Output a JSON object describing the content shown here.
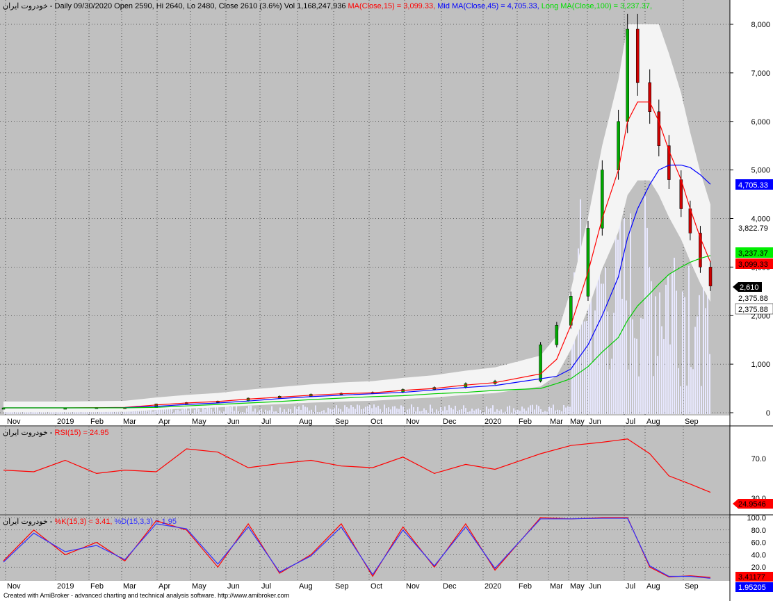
{
  "main_header": {
    "symbol": "خودروت ایران",
    "info": " - Daily 09/30/2020 Open 2590, Hi 2640, Lo 2480, Close 2610 (3.6%) Vol 1,168,247,936 ",
    "ma_label": "MA(Close,15) = 3,099.33, ",
    "mid_label": "Mid MA(Close,45) = 4,705.33, ",
    "long_label": "Long MA(Close,100) = 3,237.37,"
  },
  "rsi_header": {
    "symbol": "خودروت ایران",
    "sep": " - ",
    "label": "RSI(15) = 24.95"
  },
  "stoch_header": {
    "symbol": "خودروت ایران",
    "sep": " - ",
    "k_label": "%K(15,3) = 3.41, ",
    "d_label": "%D(15,3,3) = 1.95"
  },
  "main_axis": [
    "8,000",
    "7,000",
    "6,000",
    "5,000",
    "4,000",
    "3,000",
    "2,000",
    "1,000",
    "0"
  ],
  "rsi_axis": [
    "70.0",
    "30.0"
  ],
  "stoch_axis": [
    "100.0",
    "80.0",
    "60.0",
    "40.0",
    "20.0"
  ],
  "badges": {
    "mid": "4,705.33",
    "upper": "3,822.79",
    "long": "3,237.37",
    "ma": "3,099.33",
    "close": "2,610",
    "lower1": "2,375.88",
    "lower2": "2,375.88",
    "rsi": "24.9546",
    "k": "3.41177",
    "d": "1.95205"
  },
  "months": [
    "Nov",
    "2019",
    "Feb",
    "Mar",
    "Apr",
    "May",
    "Jun",
    "Jul",
    "Aug",
    "Sep",
    "Oct",
    "Nov",
    "Dec",
    "2020",
    "Feb",
    "Mar",
    "May",
    "Jun",
    "Jul",
    "Aug",
    "Sep"
  ],
  "footer": "Created with AmiBroker - advanced charting and technical analysis software. http://www.amibroker.com",
  "colors": {
    "ma": "#ff0000",
    "mid": "#0000ff",
    "long": "#00cc00",
    "rsi": "#ff0000",
    "k": "#ff0000",
    "d": "#3030ff",
    "background": "#c0c0c0"
  },
  "chart_data": [
    {
      "type": "line",
      "title": "Daily 09/30/2020 Open 2590, Hi 2640, Lo 2480, Close 2610 (3.6%) Vol 1,168,247,936",
      "ylim": [
        0,
        8000
      ],
      "x": [
        "2018-11-01",
        "2019-01-01",
        "2019-02-01",
        "2019-03-01",
        "2019-04-01",
        "2019-05-01",
        "2019-06-01",
        "2019-07-01",
        "2019-08-01",
        "2019-09-01",
        "2019-10-01",
        "2019-11-01",
        "2019-12-01",
        "2020-01-01",
        "2020-02-01",
        "2020-03-01",
        "2020-04-15",
        "2020-05-01",
        "2020-05-15",
        "2020-06-01",
        "2020-06-15",
        "2020-07-01",
        "2020-07-10",
        "2020-07-20",
        "2020-08-01",
        "2020-08-10",
        "2020-08-20",
        "2020-09-01",
        "2020-09-10",
        "2020-09-20",
        "2020-09-30"
      ],
      "series": [
        {
          "name": "Close",
          "values": [
            100,
            100,
            110,
            105,
            180,
            210,
            240,
            300,
            340,
            380,
            400,
            420,
            480,
            520,
            600,
            650,
            1400,
            1800,
            2400,
            3800,
            5000,
            6000,
            7900,
            6800,
            6200,
            5500,
            4800,
            4200,
            3700,
            3000,
            2610
          ]
        },
        {
          "name": "MA(Close,15)",
          "values": [
            100,
            100,
            105,
            110,
            160,
            200,
            230,
            280,
            320,
            360,
            390,
            410,
            460,
            500,
            570,
            620,
            800,
            1100,
            1800,
            2900,
            4000,
            5000,
            6000,
            6400,
            6400,
            6000,
            5400,
            4800,
            4200,
            3600,
            3099.33
          ]
        },
        {
          "name": "Mid MA(Close,45)",
          "values": [
            100,
            100,
            100,
            105,
            130,
            170,
            200,
            240,
            290,
            330,
            360,
            390,
            420,
            470,
            520,
            560,
            700,
            750,
            900,
            1400,
            2000,
            2800,
            3600,
            4200,
            4700,
            5000,
            5100,
            5100,
            5050,
            4900,
            4705.33
          ]
        },
        {
          "name": "Long MA(Close,100)",
          "values": [
            100,
            100,
            100,
            100,
            110,
            140,
            170,
            200,
            230,
            270,
            300,
            330,
            350,
            390,
            420,
            460,
            500,
            600,
            700,
            950,
            1250,
            1550,
            1900,
            2200,
            2450,
            2650,
            2850,
            3000,
            3100,
            3180,
            3237.37
          ]
        }
      ]
    },
    {
      "type": "line",
      "title": "RSI(15) = 24.95",
      "ylim": [
        0,
        100
      ],
      "x": [
        "2018-11-01",
        "2018-12-01",
        "2019-01-01",
        "2019-02-01",
        "2019-03-01",
        "2019-04-01",
        "2019-05-01",
        "2019-06-01",
        "2019-07-01",
        "2019-08-01",
        "2019-09-01",
        "2019-10-01",
        "2019-11-01",
        "2019-12-01",
        "2020-01-01",
        "2020-02-01",
        "2020-03-01",
        "2020-04-15",
        "2020-05-15",
        "2020-06-15",
        "2020-07-10",
        "2020-08-01",
        "2020-08-20",
        "2020-09-10",
        "2020-09-30"
      ],
      "series": [
        {
          "name": "RSI(15)",
          "values": [
            52,
            50,
            64,
            48,
            52,
            50,
            78,
            74,
            55,
            60,
            64,
            57,
            55,
            68,
            48,
            59,
            53,
            72,
            82,
            86,
            90,
            72,
            45,
            35,
            24.95
          ]
        }
      ]
    },
    {
      "type": "line",
      "title": "%K(15,3) = 3.41, %D(15,3,3) = 1.95",
      "ylim": [
        0,
        100
      ],
      "x": [
        "2018-11-01",
        "2018-12-01",
        "2019-01-01",
        "2019-02-01",
        "2019-03-01",
        "2019-04-01",
        "2019-05-01",
        "2019-06-01",
        "2019-07-01",
        "2019-08-01",
        "2019-09-01",
        "2019-10-01",
        "2019-11-01",
        "2019-12-01",
        "2020-01-01",
        "2020-02-01",
        "2020-03-01",
        "2020-04-15",
        "2020-05-15",
        "2020-06-15",
        "2020-07-10",
        "2020-08-01",
        "2020-08-20",
        "2020-09-10",
        "2020-09-30"
      ],
      "series": [
        {
          "name": "%K(15,3)",
          "values": [
            30,
            80,
            40,
            60,
            30,
            95,
            80,
            20,
            90,
            10,
            40,
            90,
            5,
            85,
            20,
            90,
            15,
            100,
            98,
            100,
            100,
            20,
            4,
            6,
            3.41
          ]
        },
        {
          "name": "%D(15,3,3)",
          "values": [
            28,
            75,
            45,
            55,
            32,
            90,
            82,
            25,
            85,
            12,
            38,
            85,
            8,
            80,
            22,
            85,
            18,
            98,
            98,
            99,
            99,
            22,
            5,
            5,
            1.95
          ]
        }
      ]
    }
  ]
}
